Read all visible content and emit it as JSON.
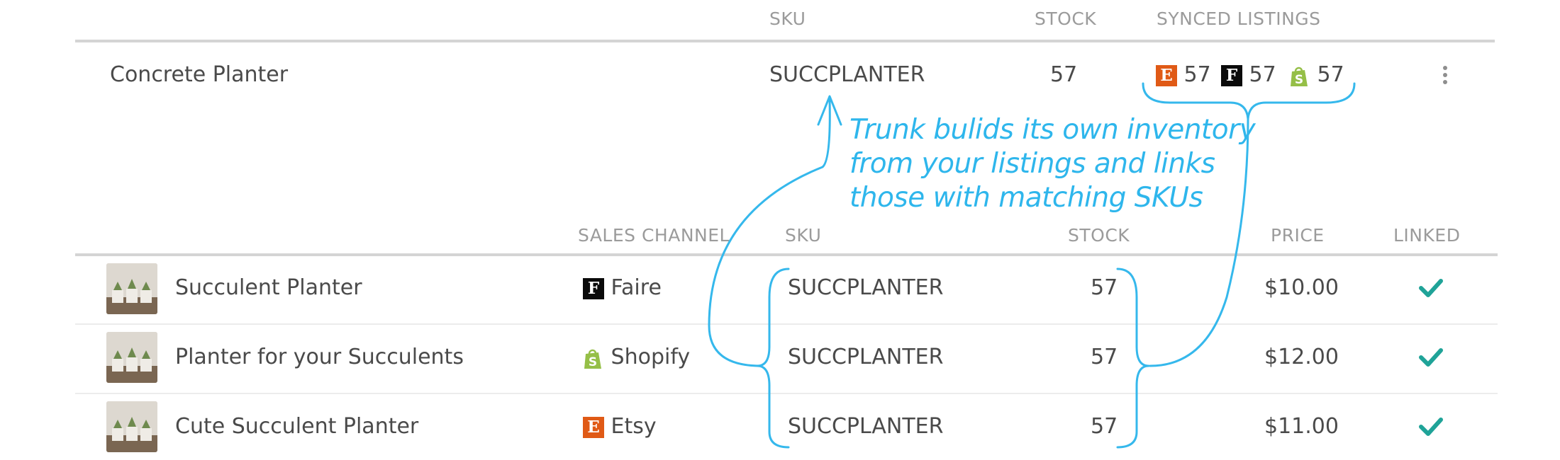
{
  "inventory": {
    "headers": {
      "sku": "SKU",
      "stock": "STOCK",
      "synced": "SYNCED LISTINGS"
    },
    "item": {
      "name": "Concrete Planter",
      "sku": "SUCCPLANTER",
      "stock": "57",
      "synced": [
        {
          "channel": "Etsy",
          "icon": "etsy-icon",
          "letter": "E",
          "count": "57"
        },
        {
          "channel": "Faire",
          "icon": "faire-icon",
          "letter": "F",
          "count": "57"
        },
        {
          "channel": "Shopify",
          "icon": "shopify-icon",
          "count": "57"
        }
      ]
    }
  },
  "annotation": {
    "lines": [
      "Trunk bulids its own inventory",
      "from your listings and links",
      "those with matching SKUs"
    ]
  },
  "listings": {
    "headers": {
      "channel": "SALES CHANNEL",
      "sku": "SKU",
      "stock": "STOCK",
      "price": "PRICE",
      "linked": "LINKED"
    },
    "rows": [
      {
        "name": "Succulent Planter",
        "channel": "Faire",
        "channel_icon": "faire-icon",
        "sku": "SUCCPLANTER",
        "stock": "57",
        "price": "$10.00",
        "linked": true
      },
      {
        "name": "Planter for your Succulents",
        "channel": "Shopify",
        "channel_icon": "shopify-icon",
        "sku": "SUCCPLANTER",
        "stock": "57",
        "price": "$12.00",
        "linked": true
      },
      {
        "name": "Cute Succulent Planter",
        "channel": "Etsy",
        "channel_icon": "etsy-icon",
        "sku": "SUCCPLANTER",
        "stock": "57",
        "price": "$11.00",
        "linked": true
      }
    ]
  },
  "colors": {
    "etsy": "#e05a16",
    "faire": "#0a0a0a",
    "shopify": "#95bf47",
    "check": "#1fa398",
    "annotation": "#2eb6ec"
  }
}
